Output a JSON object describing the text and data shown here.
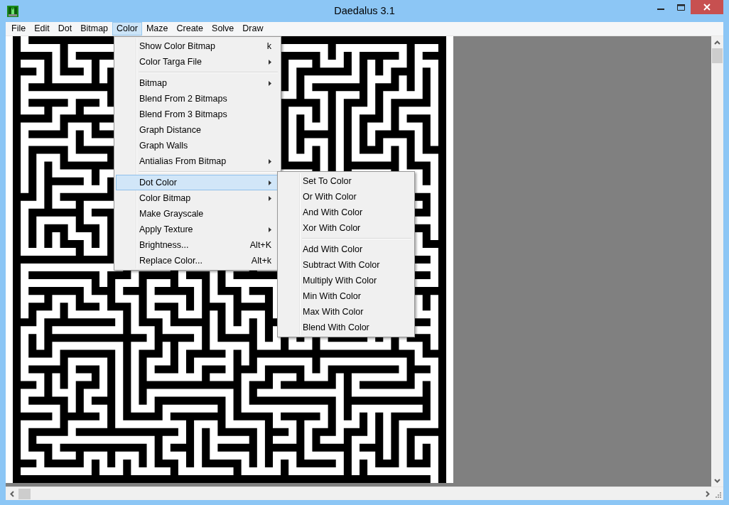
{
  "window": {
    "title": "Daedalus 3.1"
  },
  "menubar": [
    {
      "label": "File",
      "selected": false
    },
    {
      "label": "Edit",
      "selected": false
    },
    {
      "label": "Dot",
      "selected": false
    },
    {
      "label": "Bitmap",
      "selected": false
    },
    {
      "label": "Color",
      "selected": true
    },
    {
      "label": "Maze",
      "selected": false
    },
    {
      "label": "Create",
      "selected": false
    },
    {
      "label": "Solve",
      "selected": false
    },
    {
      "label": "Draw",
      "selected": false
    }
  ],
  "color_menu": {
    "groups": [
      [
        {
          "label": "Show Color Bitmap",
          "shortcut": "k",
          "submenu": false,
          "selected": false
        },
        {
          "label": "Color Targa File",
          "submenu": true,
          "selected": false
        }
      ],
      [
        {
          "label": "Bitmap",
          "submenu": true,
          "selected": false
        },
        {
          "label": "Blend From 2 Bitmaps",
          "submenu": false,
          "selected": false
        },
        {
          "label": "Blend From 3 Bitmaps",
          "submenu": false,
          "selected": false
        },
        {
          "label": "Graph Distance",
          "submenu": false,
          "selected": false
        },
        {
          "label": "Graph Walls",
          "submenu": false,
          "selected": false
        },
        {
          "label": "Antialias From Bitmap",
          "submenu": true,
          "selected": false
        }
      ],
      [
        {
          "label": "Dot Color",
          "submenu": true,
          "selected": true
        },
        {
          "label": "Color Bitmap",
          "submenu": true,
          "selected": false
        },
        {
          "label": "Make Grayscale",
          "submenu": false,
          "selected": false
        },
        {
          "label": "Apply Texture",
          "submenu": true,
          "selected": false
        },
        {
          "label": "Brightness...",
          "shortcut": "Alt+K",
          "submenu": false,
          "selected": false
        },
        {
          "label": "Replace Color...",
          "shortcut": "Alt+k",
          "submenu": false,
          "selected": false
        }
      ]
    ]
  },
  "dot_color_submenu": {
    "groups": [
      [
        {
          "label": "Set To Color",
          "submenu": false,
          "selected": false
        },
        {
          "label": "Or With Color",
          "submenu": false,
          "selected": false
        },
        {
          "label": "And With Color",
          "submenu": false,
          "selected": false
        },
        {
          "label": "Xor With Color",
          "submenu": false,
          "selected": false
        }
      ],
      [
        {
          "label": "Add With Color",
          "submenu": false,
          "selected": false
        },
        {
          "label": "Subtract With Color",
          "submenu": false,
          "selected": false
        },
        {
          "label": "Multiply With Color",
          "submenu": false,
          "selected": false
        },
        {
          "label": "Min With Color",
          "submenu": false,
          "selected": false
        },
        {
          "label": "Max With Color",
          "submenu": false,
          "selected": false
        },
        {
          "label": "Blend With Color",
          "submenu": false,
          "selected": false
        }
      ]
    ]
  }
}
